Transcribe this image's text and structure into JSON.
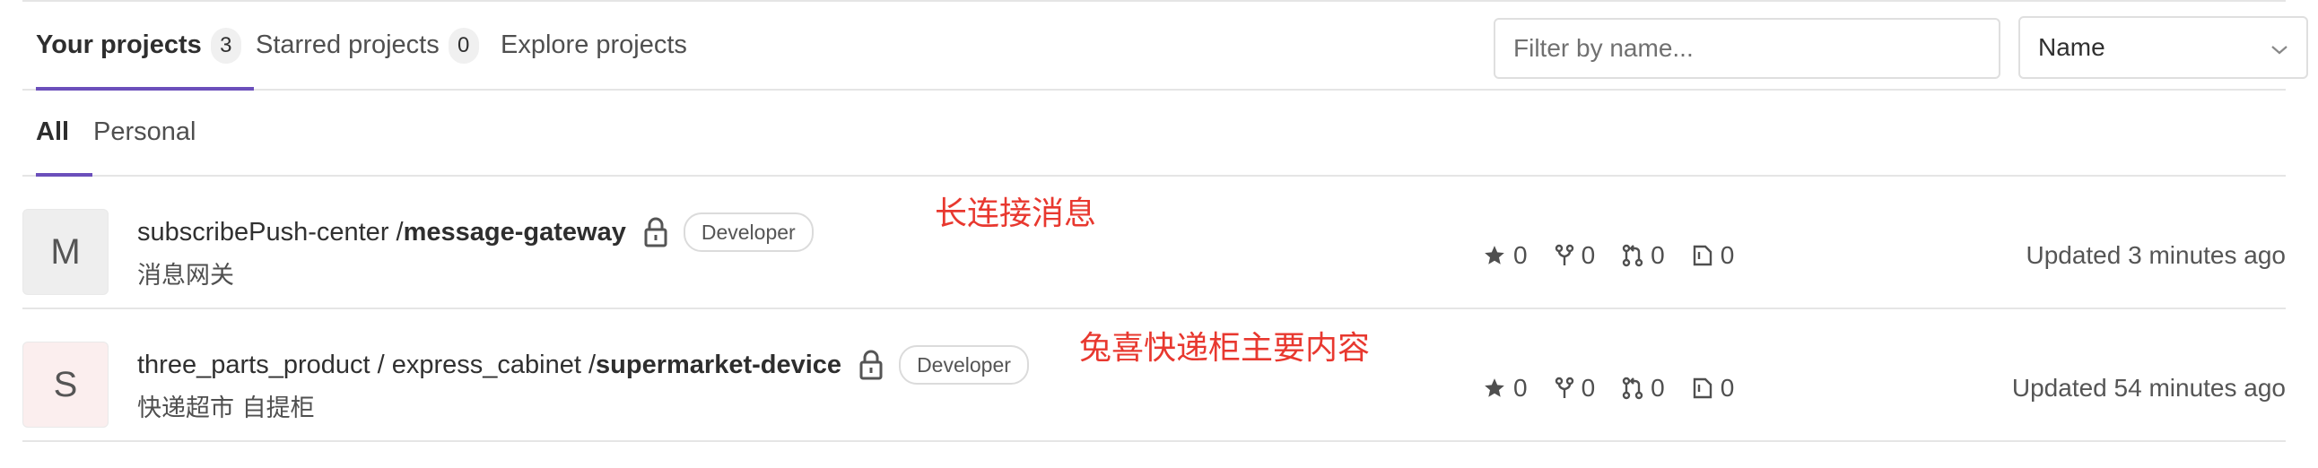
{
  "tabs": [
    {
      "label": "Your projects",
      "count": "3"
    },
    {
      "label": "Starred projects",
      "count": "0"
    },
    {
      "label": "Explore projects"
    }
  ],
  "filter": {
    "placeholder": "Filter by name..."
  },
  "sort": {
    "selected": "Name",
    "icon": "chevron-down-icon"
  },
  "subtabs": [
    {
      "label": "All"
    },
    {
      "label": "Personal"
    }
  ],
  "colors": {
    "accent": "#6b4fbb",
    "annotation": "#e8382f"
  },
  "projects": [
    {
      "avatar_letter": "M",
      "namespace": "subscribePush-center / ",
      "name": "message-gateway",
      "role": "Developer",
      "description": "消息网关",
      "annotation": "长连接消息",
      "stars": "0",
      "forks": "0",
      "merge_requests": "0",
      "issues": "0",
      "updated": "Updated 3 minutes ago"
    },
    {
      "avatar_letter": "S",
      "namespace": "three_parts_product / express_cabinet / ",
      "name": "supermarket-device",
      "role": "Developer",
      "description": "快递超市 自提柜",
      "annotation": "兔喜快递柜主要内容",
      "stars": "0",
      "forks": "0",
      "merge_requests": "0",
      "issues": "0",
      "updated": "Updated 54 minutes ago"
    }
  ]
}
